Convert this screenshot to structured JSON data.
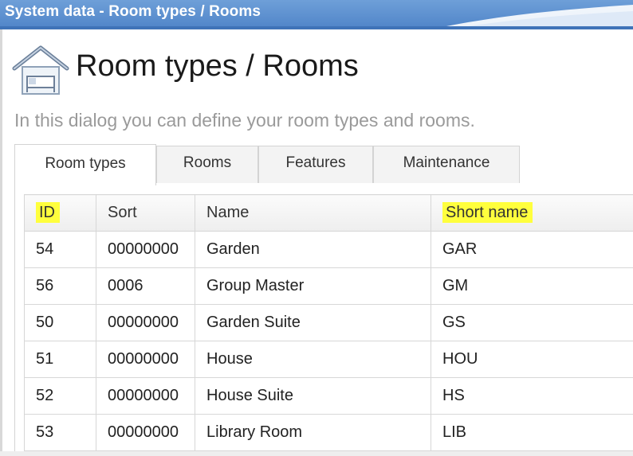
{
  "window": {
    "title": "System data - Room types / Rooms"
  },
  "header": {
    "icon": "house-bed-icon",
    "title": "Room types / Rooms",
    "description": "In this dialog you can define your room types and rooms."
  },
  "tabs": [
    {
      "label": "Room types",
      "active": true
    },
    {
      "label": "Rooms",
      "active": false
    },
    {
      "label": "Features",
      "active": false
    },
    {
      "label": "Maintenance",
      "active": false
    }
  ],
  "grid": {
    "columns": [
      "ID",
      "Sort",
      "Name",
      "Short name"
    ],
    "highlighted_columns": [
      "ID",
      "Short name"
    ],
    "highlight_color": "#ffff3d",
    "rows": [
      {
        "id": "54",
        "sort": "00000000",
        "name": "Garden",
        "short": "GAR"
      },
      {
        "id": "56",
        "sort": "0006",
        "name": "Group Master",
        "short": "GM"
      },
      {
        "id": "50",
        "sort": "00000000",
        "name": "Garden Suite",
        "short": "GS"
      },
      {
        "id": "51",
        "sort": "00000000",
        "name": "House",
        "short": "HOU"
      },
      {
        "id": "52",
        "sort": "00000000",
        "name": "House Suite",
        "short": "HS"
      },
      {
        "id": "53",
        "sort": "00000000",
        "name": "Library Room",
        "short": "LIB"
      }
    ]
  },
  "colors": {
    "titlebar": "#4f84c8",
    "title_text": "#ffffff",
    "description_text": "#9a9a9a"
  }
}
